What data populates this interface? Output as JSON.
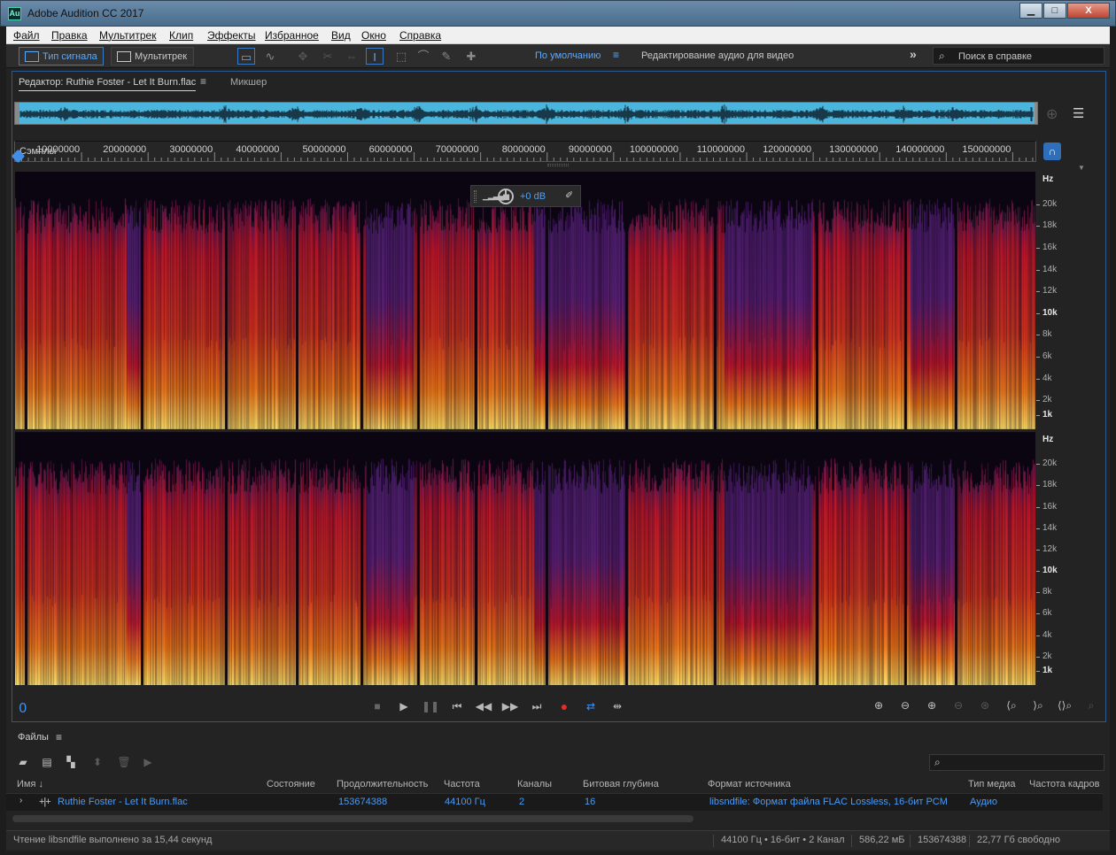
{
  "window": {
    "icon_text": "Au",
    "title": "Adobe Audition CC 2017",
    "minimize": "▁",
    "maximize": "□",
    "close": "X"
  },
  "menubar": [
    "Файл",
    "Правка",
    "Мультитрек",
    "Клип",
    "Эффекты",
    "Избранное",
    "Вид",
    "Окно",
    "Справка"
  ],
  "toolbar": {
    "mode_waveform": "Тип сигнала",
    "mode_multitrack": "Мультитрек",
    "workspace_default": "По умолчанию",
    "workspace_video": "Редактирование аудио для видео",
    "more": "»",
    "help_placeholder": "Поиск в справке"
  },
  "editor": {
    "tab_editor": "Редактор: Ruthie Foster - Let It Burn.flac",
    "tab_mixer": "Микшер",
    "ruler_units_label": "Сэмплы",
    "ruler_ticks": [
      "10000000",
      "20000000",
      "30000000",
      "40000000",
      "50000000",
      "60000000",
      "70000000",
      "80000000",
      "90000000",
      "100000000",
      "110000000",
      "120000000",
      "130000000",
      "140000000",
      "150000000"
    ],
    "hud_gain": "+0 dB",
    "freq_unit": "Hz",
    "freq_labels": [
      "20k",
      "18k",
      "16k",
      "14k",
      "12k",
      "10k",
      "8k",
      "6k",
      "4k",
      "2k",
      "1k"
    ],
    "time": "0",
    "spectral_colors": {
      "background": "#0b0511",
      "low": "#ffe067",
      "mid": "#f07a1c",
      "high": "#c0162b",
      "top": "#4a1d6b"
    },
    "accent": "#3d8ff0"
  },
  "files": {
    "title": "Файлы",
    "search_placeholder": "",
    "columns": [
      "Имя",
      "Состояние",
      "Продолжительность",
      "Частота",
      "Каналы",
      "Битовая глубина",
      "Формат источника",
      "Тип медиа",
      "Частота кадров"
    ],
    "sort_arrow": "↓",
    "rows": [
      {
        "name": "Ruthie Foster - Let It Burn.flac",
        "status": "",
        "duration": "153674388",
        "rate": "44100 Гц",
        "channels": "2",
        "bit_depth": "16",
        "source_format": "libsndfile: Формат файла FLAC Lossless, 16-бит PCM",
        "media_type": "Аудио",
        "frame_rate": ""
      }
    ]
  },
  "status": {
    "message": "Чтение libsndfile выполнено за 15,44 секунд",
    "format": "44100 Гц • 16-бит • 2 Канал",
    "size": "586,22 мБ",
    "samples": "153674388",
    "free": "22,77 Гб свободно"
  }
}
